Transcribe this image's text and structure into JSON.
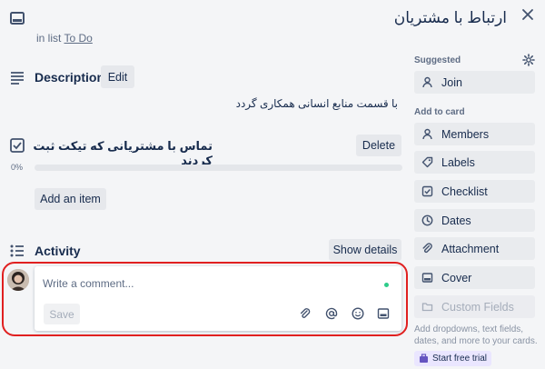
{
  "card": {
    "title": "ارتباط با مشتریان",
    "in_list_prefix": "in list",
    "list_name": "To Do"
  },
  "description": {
    "heading": "Description",
    "edit_label": "Edit",
    "text": "با قسمت منابع انسانی همکاری گردد"
  },
  "checklist": {
    "title": "تماس با مشتریانی که تیکت ثبت کردند",
    "delete_label": "Delete",
    "progress_text": "0%",
    "progress_fraction": 0,
    "add_item_label": "Add an item"
  },
  "activity": {
    "heading": "Activity",
    "show_details_label": "Show details"
  },
  "comment": {
    "placeholder": "Write a comment...",
    "save_label": "Save",
    "tools": [
      "attachment-icon",
      "mention-icon",
      "emoji-icon",
      "card-icon"
    ]
  },
  "sidebar": {
    "suggested_label": "Suggested",
    "join_label": "Join",
    "add_to_card_label": "Add to card",
    "buttons": [
      {
        "label": "Members",
        "icon": "person-icon"
      },
      {
        "label": "Labels",
        "icon": "tag-icon"
      },
      {
        "label": "Checklist",
        "icon": "checkbox-icon"
      },
      {
        "label": "Dates",
        "icon": "clock-icon"
      },
      {
        "label": "Attachment",
        "icon": "paperclip-icon"
      },
      {
        "label": "Cover",
        "icon": "cover-icon"
      },
      {
        "label": "Custom Fields",
        "icon": "folder-icon"
      }
    ],
    "upgrade_note": "Add dropdowns, text fields, dates, and more to your cards.",
    "trial_label": "Start free trial"
  },
  "colors": {
    "accent_highlight": "#e02020",
    "progress": "#5ba4cf",
    "online_dot": "#2ecc8a"
  }
}
